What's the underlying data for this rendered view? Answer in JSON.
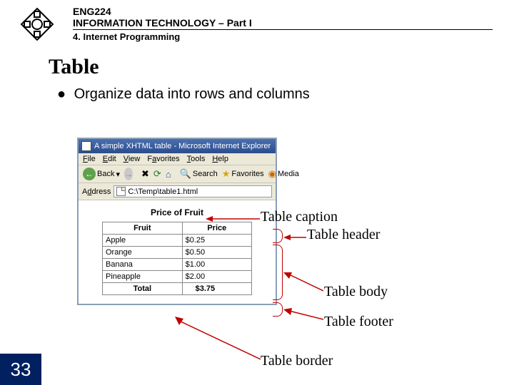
{
  "header": {
    "course_code": "ENG224",
    "course_title": "INFORMATION TECHNOLOGY – Part I",
    "section": "4. Internet Programming"
  },
  "slide": {
    "title": "Table",
    "bullet": "Organize data into rows and columns"
  },
  "browser": {
    "window_title": "A simple XHTML table - Microsoft Internet Explorer",
    "menu": {
      "file": "File",
      "edit": "Edit",
      "view": "View",
      "favorites": "Favorites",
      "tools": "Tools",
      "help": "Help"
    },
    "toolbar": {
      "back": "Back",
      "search": "Search",
      "favorites": "Favorites",
      "media": "Media"
    },
    "address_label": "Address",
    "address_value": "C:\\Temp\\table1.html"
  },
  "table": {
    "caption": "Price of Fruit",
    "head": {
      "col1": "Fruit",
      "col2": "Price"
    },
    "rows": [
      {
        "item": "Apple",
        "price": "$0.25"
      },
      {
        "item": "Orange",
        "price": "$0.50"
      },
      {
        "item": "Banana",
        "price": "$1.00"
      },
      {
        "item": "Pineapple",
        "price": "$2.00"
      }
    ],
    "foot": {
      "label": "Total",
      "value": "$3.75"
    }
  },
  "annotations": {
    "caption": "Table caption",
    "header": "Table header",
    "body": "Table body",
    "footer": "Table footer",
    "border": "Table border"
  },
  "page_number": "33"
}
